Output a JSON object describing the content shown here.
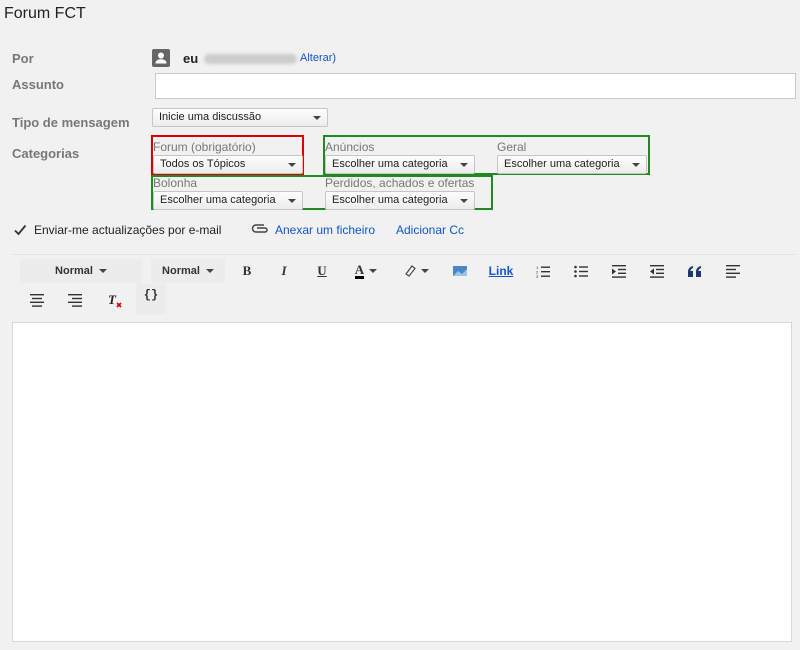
{
  "window": {
    "title": "Forum FCT"
  },
  "form": {
    "labels": {
      "from": "Por",
      "subject": "Assunto",
      "type": "Tipo de mensagem",
      "categories": "Categorias"
    },
    "from": {
      "name": "eu",
      "change_link": "Alterar",
      "close_paren": ")"
    },
    "subject_value": "",
    "message_type": {
      "selected": "Inicie uma discussão"
    },
    "categories": {
      "forum": {
        "label": "Forum (obrigatório)",
        "selected": "Todos os Tópicos"
      },
      "anuncios": {
        "label": "Anúncios",
        "selected": "Escolher uma categoria"
      },
      "geral": {
        "label": "Geral",
        "selected": "Escolher uma categoria"
      },
      "bolonha": {
        "label": "Bolonha",
        "selected": "Escolher uma categoria"
      },
      "perdidos": {
        "label": "Perdidos, achados e ofertas",
        "selected": "Escolher uma categoria"
      }
    },
    "email_updates": {
      "label": "Enviar-me actualizações por e-mail",
      "checked": true
    },
    "attach_label": "Anexar um ficheiro",
    "add_cc_label": "Adicionar Cc"
  },
  "toolbar": {
    "font": "Normal",
    "size": "Normal",
    "bold": "B",
    "italic": "I",
    "underline": "U",
    "text_color": "A",
    "link": "Link",
    "code": "{}"
  },
  "colors": {
    "link": "#1155cc",
    "required_border": "#dd0000",
    "optional_border": "#228822"
  }
}
